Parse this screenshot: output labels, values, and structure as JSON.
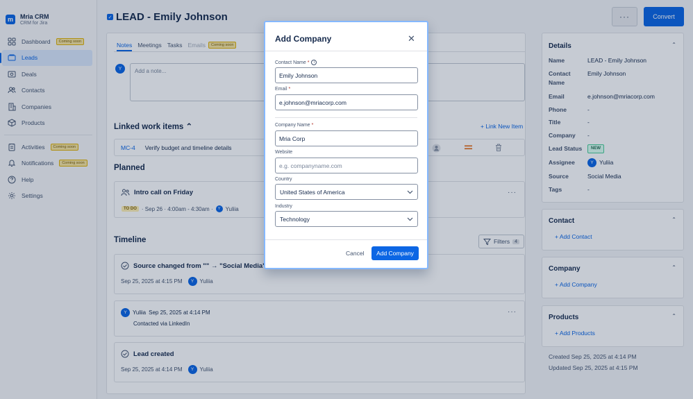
{
  "brand": {
    "name": "Mria CRM",
    "subtitle": "CRM for Jira"
  },
  "sidebar": {
    "items": [
      {
        "label": "Dashboard",
        "badge": "Coming soon",
        "icon": "dashboard-icon"
      },
      {
        "label": "Leads",
        "active": true,
        "icon": "leads-icon"
      },
      {
        "label": "Deals",
        "icon": "deals-icon"
      },
      {
        "label": "Contacts",
        "icon": "contacts-icon"
      },
      {
        "label": "Companies",
        "icon": "companies-icon"
      },
      {
        "label": "Products",
        "icon": "products-icon"
      }
    ],
    "items2": [
      {
        "label": "Activities",
        "badge": "Coming soon",
        "icon": "activities-icon"
      },
      {
        "label": "Notifications",
        "badge": "Coming soon",
        "icon": "bell-icon"
      },
      {
        "label": "Help",
        "icon": "help-icon"
      },
      {
        "label": "Settings",
        "icon": "gear-icon"
      }
    ]
  },
  "header": {
    "title": "LEAD - Emily Johnson",
    "more_label": "···",
    "convert_label": "Convert"
  },
  "tabs": [
    {
      "label": "Notes"
    },
    {
      "label": "Meetings"
    },
    {
      "label": "Tasks"
    },
    {
      "label": "Emails",
      "badge": "Coming soon"
    }
  ],
  "note": {
    "avatar": "Y",
    "placeholder": "Add a note..."
  },
  "linked": {
    "title": "Linked work items ⌃",
    "new_link": "+ Link New Item",
    "row": {
      "key": "MC-4",
      "summary": "Verify budget and timeline details"
    }
  },
  "planned": {
    "title": "Planned",
    "card": {
      "title": "Intro call on Friday",
      "status": "TO DO",
      "when": "· Sep 26 · 4:00am - 4:30am ·",
      "avatar": "Y",
      "user": "Yuliia"
    }
  },
  "timeline": {
    "title": "Timeline",
    "filters_label": "Filters",
    "filters_count": "4",
    "events": [
      {
        "title": "Source changed from \"\" → \"Social Media\"",
        "date": "Sep 25, 2025 at 4:15 PM",
        "avatar": "Y",
        "user": "Yuliia"
      },
      {
        "user": "Yuliia",
        "date": "Sep 25, 2025 at 4:14 PM",
        "body": "Contacted via LinkedIn",
        "avatar": "Y"
      },
      {
        "title": "Lead created",
        "date": "Sep 25, 2025 at 4:14 PM",
        "avatar": "Y",
        "user": "Yuliia"
      }
    ]
  },
  "details": {
    "title": "Details",
    "rows": [
      {
        "label": "Name",
        "value": "LEAD - Emily Johnson"
      },
      {
        "label": "Contact Name",
        "value": "Emily Johnson"
      },
      {
        "label": "Email",
        "value": "e.johnson@mriacorp.com"
      },
      {
        "label": "Phone",
        "value": "-"
      },
      {
        "label": "Title",
        "value": "-"
      },
      {
        "label": "Company",
        "value": "-"
      },
      {
        "label": "Lead Status",
        "value": "NEW"
      },
      {
        "label": "Assignee",
        "value": "Yuliia",
        "avatar": "Y"
      },
      {
        "label": "Source",
        "value": "Social Media"
      },
      {
        "label": "Tags",
        "value": "-"
      }
    ]
  },
  "contact_card": {
    "title": "Contact",
    "add": "+  Add Contact"
  },
  "company_card": {
    "title": "Company",
    "add": "+  Add Company"
  },
  "products_card": {
    "title": "Products",
    "add": "+  Add Products"
  },
  "footer": {
    "created": "Created Sep 25, 2025 at 4:14 PM",
    "updated": "Updated Sep 25, 2025 at 4:15 PM"
  },
  "modal": {
    "title": "Add Company",
    "contact_label": "Contact Name",
    "contact_value": "Emily Johnson",
    "email_label": "Email",
    "email_value": "e.johnson@mriacorp.com",
    "company_label": "Company Name",
    "company_value": "Mria Corp",
    "website_label": "Website",
    "website_placeholder": "e.g. companyname.com",
    "country_label": "Country",
    "country_value": "United States of America",
    "industry_label": "Industry",
    "industry_value": "Technology",
    "cancel_label": "Cancel",
    "submit_label": "Add Company"
  },
  "colors": {
    "brand": "#0c66e4",
    "overlay": "#091e42",
    "warning_badge": "#f8e6a0",
    "new_badge": "#dcfff1"
  }
}
